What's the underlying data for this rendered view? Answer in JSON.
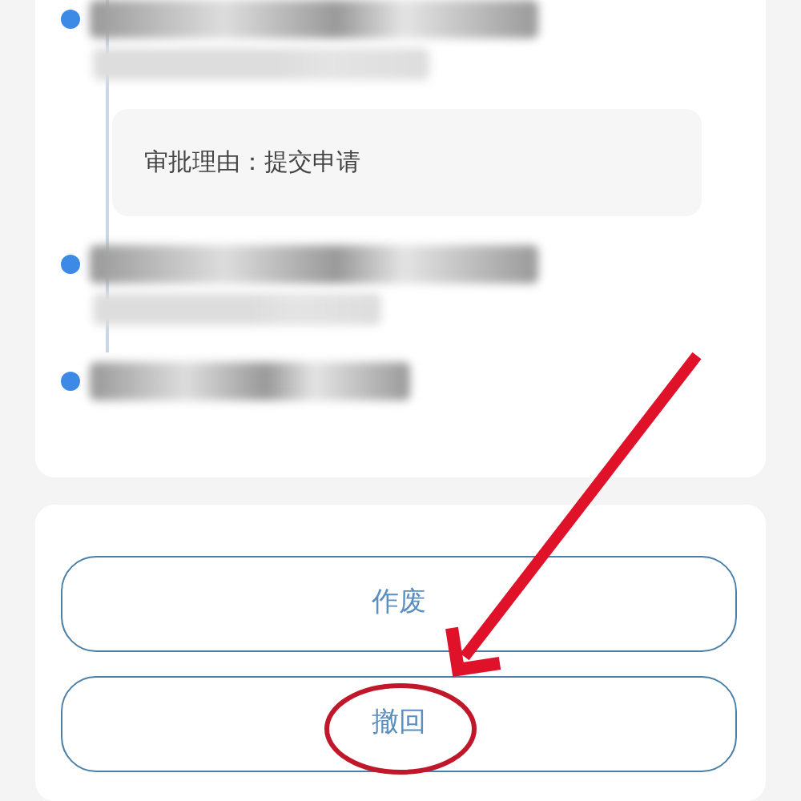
{
  "timeline": [
    {
      "kind": "redacted",
      "reason": "审批理由：提交申请"
    },
    {
      "kind": "redacted"
    },
    {
      "kind": "redacted"
    }
  ],
  "buttons": [
    {
      "label": "作废",
      "highlighted": false
    },
    {
      "label": "撤回",
      "highlighted": true
    }
  ],
  "annotation": {
    "kind": "arrow"
  }
}
